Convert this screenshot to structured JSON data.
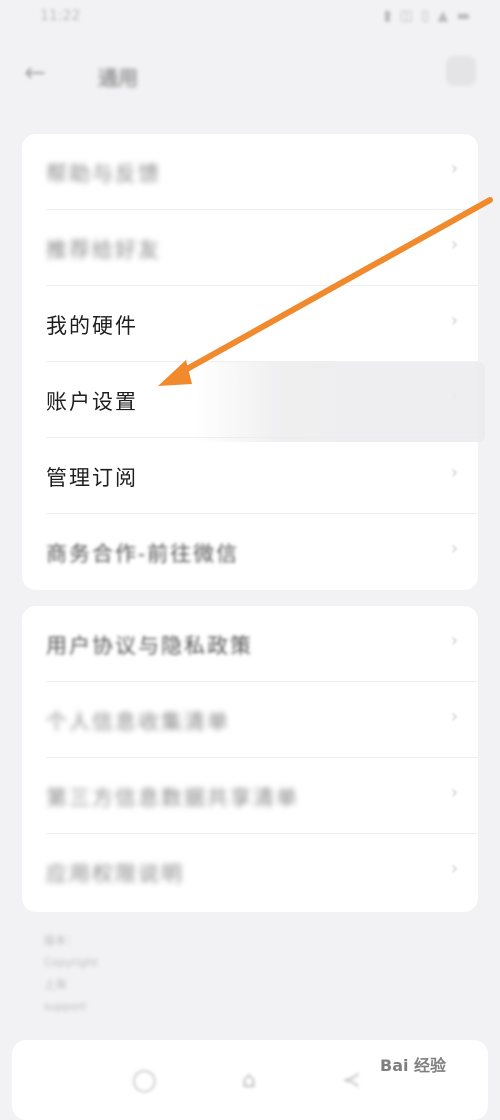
{
  "status_bar": {
    "time": "11:22",
    "icons": "▮ ◫ ▯ ▲ ▬"
  },
  "nav": {
    "title": "通用"
  },
  "card1": {
    "items": [
      {
        "label": "帮助与反馈"
      },
      {
        "label": "推荐给好友"
      },
      {
        "label": "我的硬件"
      },
      {
        "label": "账户设置"
      },
      {
        "label": "管理订阅"
      },
      {
        "label": "商务合作-前往微信"
      }
    ]
  },
  "card2": {
    "items": [
      {
        "label": "用户协议与隐私政策"
      },
      {
        "label": "个人信息收集清单"
      },
      {
        "label": "第三方信息数据共享清单"
      },
      {
        "label": "应用权限说明"
      }
    ]
  },
  "chevron": "›",
  "footer": {
    "lines": [
      "版本：",
      "Copyright",
      "上海",
      "support"
    ]
  },
  "bottom_bar": {
    "promo": ""
  },
  "watermark": {
    "text": "Bai 经验",
    "paw": "du"
  },
  "annotation": {
    "arrow_color": "#f08a2c"
  }
}
